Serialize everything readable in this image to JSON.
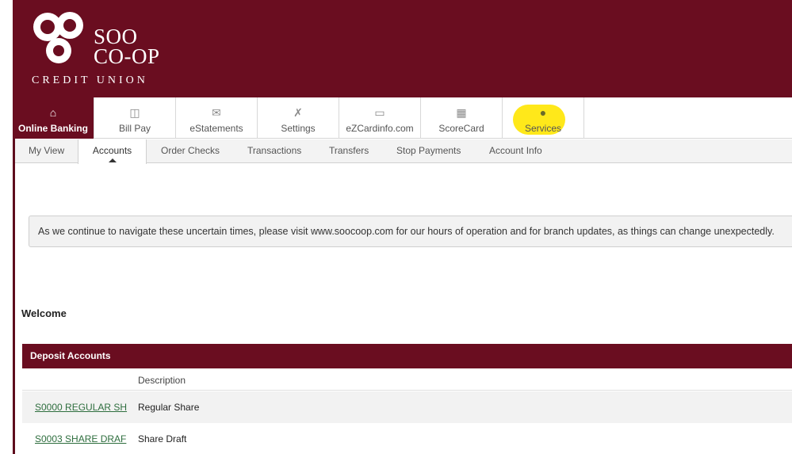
{
  "brand": {
    "line1": "SOO",
    "line2": "CO-OP",
    "line3": "CREDIT UNION"
  },
  "nav": {
    "items": [
      {
        "label": "Online Banking",
        "icon": "home-icon"
      },
      {
        "label": "Bill Pay",
        "icon": "bill-pay-icon"
      },
      {
        "label": "eStatements",
        "icon": "envelope-icon"
      },
      {
        "label": "Settings",
        "icon": "tools-icon"
      },
      {
        "label": "eZCardinfo.com",
        "icon": "card-icon"
      },
      {
        "label": "ScoreCard",
        "icon": "gift-icon"
      },
      {
        "label": "Services",
        "icon": "lightbulb-icon"
      }
    ],
    "active": "Online Banking",
    "highlight_color": "#ffe81a"
  },
  "subnav": {
    "items": [
      "My View",
      "Accounts",
      "Order Checks",
      "Transactions",
      "Transfers",
      "Stop Payments",
      "Account Info"
    ],
    "active": "Accounts"
  },
  "notice": "As we continue to navigate these uncertain times, please visit www.soocoop.com for our hours of operation and for branch updates, as things can change unexpectedly.",
  "welcome": "Welcome",
  "deposit_accounts": {
    "title": "Deposit Accounts",
    "column_description": "Description",
    "rows": [
      {
        "account": "S0000 REGULAR SH",
        "description": "Regular Share"
      },
      {
        "account": "S0003 SHARE DRAF",
        "description": "Share Draft"
      }
    ]
  },
  "colors": {
    "brand_maroon": "#6a0d20",
    "link_green": "#2e6e3e"
  }
}
